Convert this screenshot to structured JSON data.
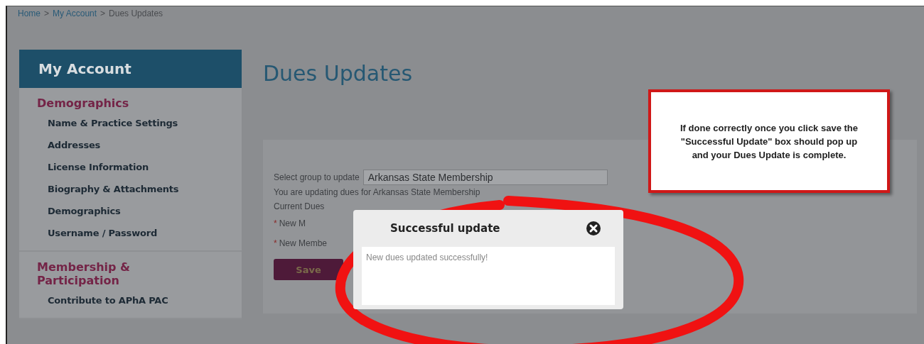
{
  "breadcrumb": {
    "separator": ">",
    "items": [
      {
        "label": "Home",
        "kind": "link"
      },
      {
        "label": "My Account",
        "kind": "link"
      },
      {
        "label": "Dues Updates",
        "kind": "current"
      }
    ]
  },
  "sidebar": {
    "title": "My Account",
    "sections": [
      {
        "heading": "Demographics",
        "items": [
          "Name & Practice Settings",
          "Addresses",
          "License Information",
          "Biography & Attachments",
          "Demographics",
          "Username / Password"
        ]
      },
      {
        "heading": "Membership & Participation",
        "items": [
          "Contribute to APhA PAC"
        ]
      }
    ]
  },
  "main": {
    "title": "Dues Updates",
    "form": {
      "group_label": "Select group to update",
      "group_value": "Arkansas State Membership",
      "info": "You are updating dues for Arkansas State Membership",
      "current_dues_label": "Current Dues",
      "required_mark": "*",
      "fields": [
        {
          "label": "New M",
          "required": true
        },
        {
          "label": "New Membe",
          "required": true
        }
      ],
      "save_button": "Save"
    }
  },
  "modal": {
    "title": "Successful update",
    "message": "New dues updated successfully!"
  },
  "callout": {
    "text": "If done correctly once you click save the \"Successful Update\" box should pop up and your Dues Update is complete."
  }
}
